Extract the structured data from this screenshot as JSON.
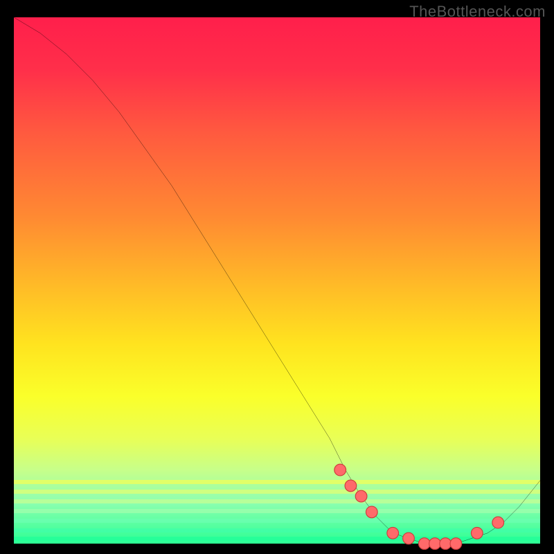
{
  "watermark": "TheBottleneck.com",
  "chart_data": {
    "type": "line",
    "title": "",
    "xlabel": "",
    "ylabel": "",
    "xlim": [
      0,
      100
    ],
    "ylim": [
      0,
      100
    ],
    "series": [
      {
        "name": "bottleneck-curve",
        "x": [
          0,
          5,
          10,
          15,
          20,
          25,
          30,
          35,
          40,
          45,
          50,
          55,
          60,
          63,
          66,
          69,
          72,
          75,
          78,
          81,
          84,
          87,
          90,
          93,
          96,
          100
        ],
        "y": [
          100,
          97,
          93,
          88,
          82,
          75,
          68,
          60,
          52,
          44,
          36,
          28,
          20,
          14,
          9,
          5,
          2,
          1,
          0,
          0,
          0,
          1,
          2,
          4,
          7,
          12
        ]
      }
    ],
    "markers": {
      "name": "highlight-points",
      "x": [
        62,
        64,
        66,
        68,
        72,
        75,
        78,
        80,
        82,
        84,
        88,
        92
      ],
      "y": [
        14,
        11,
        9,
        6,
        2,
        1,
        0,
        0,
        0,
        0,
        2,
        4
      ]
    },
    "gradient_stops": [
      {
        "pct": 0,
        "color": "#ff1f4b"
      },
      {
        "pct": 50,
        "color": "#ffb728"
      },
      {
        "pct": 72,
        "color": "#faff2a"
      },
      {
        "pct": 100,
        "color": "#2bff94"
      }
    ]
  }
}
